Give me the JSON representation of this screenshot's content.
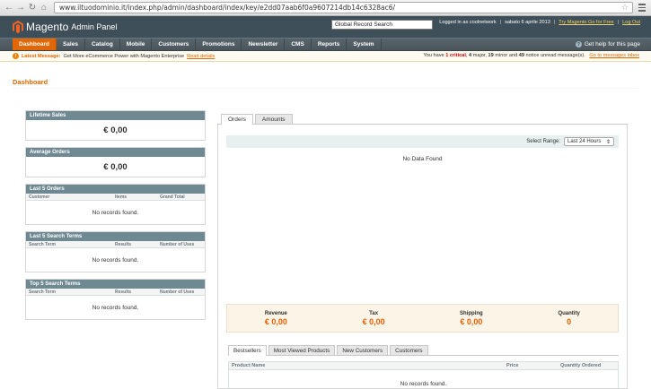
{
  "browser": {
    "url": "www.iltuodominio.it/index.php/admin/dashboard/index/key/e2dd07aab6f0a9607214db14c6328ac6/",
    "back_glyph": "←",
    "forward_glyph": "→",
    "reload_glyph": "↻",
    "home_glyph": "⌂",
    "star_glyph": "☆"
  },
  "header": {
    "logo_name": "Magento",
    "logo_sub": "Admin Panel",
    "search_value": "Global Record Search",
    "logged_in": "Logged in as coolnetwork",
    "date": "sabato 6 aprile 2013",
    "try_link": "Try Magento Go for Free",
    "logout_link": "Log Out",
    "separator": "|"
  },
  "nav": {
    "items": [
      "Dashboard",
      "Sales",
      "Catalog",
      "Mobile",
      "Customers",
      "Promotions",
      "Newsletter",
      "CMS",
      "Reports",
      "System"
    ],
    "help": "Get help for this page"
  },
  "notice": {
    "label": "Latest Message:",
    "text": "Get More eCommerce Power with Magento Enterprise",
    "read_link": "Read details",
    "summary_pre": "You have",
    "critical": "1 critical",
    "major_count": "4",
    "major_text": "major,",
    "minor_count": "19",
    "minor_text": "minor and",
    "notice_count": "49",
    "notice_text": "notice unread message(s).",
    "inbox_link": "Go to messages inbox"
  },
  "page": {
    "title": "Dashboard"
  },
  "lifetime_sales": {
    "title": "Lifetime Sales",
    "value": "€ 0,00"
  },
  "average_orders": {
    "title": "Average Orders",
    "value": "€ 0,00"
  },
  "last_orders": {
    "title": "Last 5 Orders",
    "columns": [
      "Customer",
      "Items",
      "Grand Total"
    ],
    "empty": "No records found."
  },
  "last_search": {
    "title": "Last 5 Search Terms",
    "columns": [
      "Search Term",
      "Results",
      "Number of Uses"
    ],
    "empty": "No records found."
  },
  "top_search": {
    "title": "Top 5 Search Terms",
    "columns": [
      "Search Term",
      "Results",
      "Number of Uses"
    ],
    "empty": "No records found."
  },
  "chart_panel": {
    "tabs": [
      "Orders",
      "Amounts"
    ],
    "range_label": "Select Range:",
    "range_value": "Last 24 Hours",
    "no_data": "No Data Found"
  },
  "totals": [
    {
      "label": "Revenue",
      "value": "€ 0,00"
    },
    {
      "label": "Tax",
      "value": "€ 0,00"
    },
    {
      "label": "Shipping",
      "value": "€ 0,00"
    },
    {
      "label": "Quantity",
      "value": "0"
    }
  ],
  "bottom": {
    "tabs": [
      "Bestsellers",
      "Most Viewed Products",
      "New Customers",
      "Customers"
    ],
    "columns": [
      "Product Name",
      "Price",
      "Quantity Ordered"
    ],
    "empty": "No records found."
  },
  "colors": {
    "accent": "#e26703",
    "header": "#3f4f59",
    "box_head": "#6f8992",
    "total_value": "#eb5e00"
  }
}
